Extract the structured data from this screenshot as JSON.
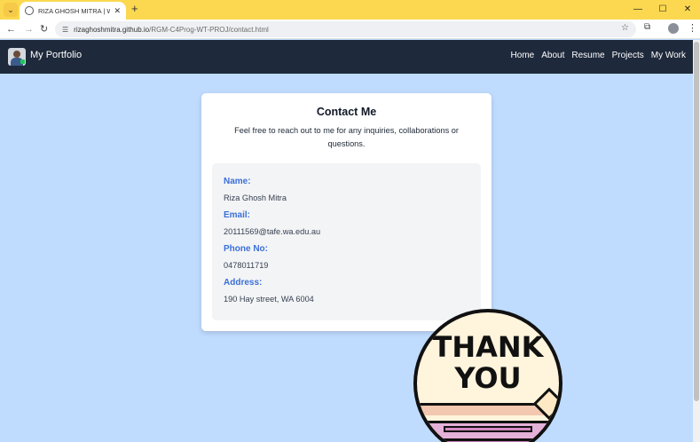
{
  "browser": {
    "tab_title": "RIZA GHOSH MITRA | Web Tech",
    "tab_close": "✕",
    "new_tab": "+",
    "url_host": "rizaghoshmitra.github.io",
    "url_path": "/RGM-C4Prog-WT-PROJ/contact.html",
    "icons": [
      "tab-search-icon",
      "back-arrow-icon",
      "forward-arrow-icon",
      "reload-icon",
      "site-info-icon",
      "bookmark-star-icon",
      "extensions-icon",
      "profile-icon",
      "menu-kebab-icon",
      "minimize-icon",
      "maximize-icon",
      "close-icon"
    ]
  },
  "site": {
    "brand": "My Portfolio",
    "nav": [
      "Home",
      "About",
      "Resume",
      "Projects",
      "My Work"
    ],
    "nav_color": "#1e293b",
    "background_color": "#bfdbfe"
  },
  "contact": {
    "title": "Contact Me",
    "subtitle": "Feel free to reach out to me for any inquiries, collaborations or questions.",
    "fields": [
      {
        "label": "Name:",
        "value": "Riza Ghosh Mitra"
      },
      {
        "label": "Email:",
        "value": "20111569@tafe.wa.edu.au"
      },
      {
        "label": "Phone No:",
        "value": "0478011719"
      },
      {
        "label": "Address:",
        "value": "190 Hay street, WA 6004"
      }
    ],
    "label_color": "#3b6fd6"
  },
  "thank_you_sticker": {
    "line1": "THANK",
    "line2": "YOU"
  }
}
